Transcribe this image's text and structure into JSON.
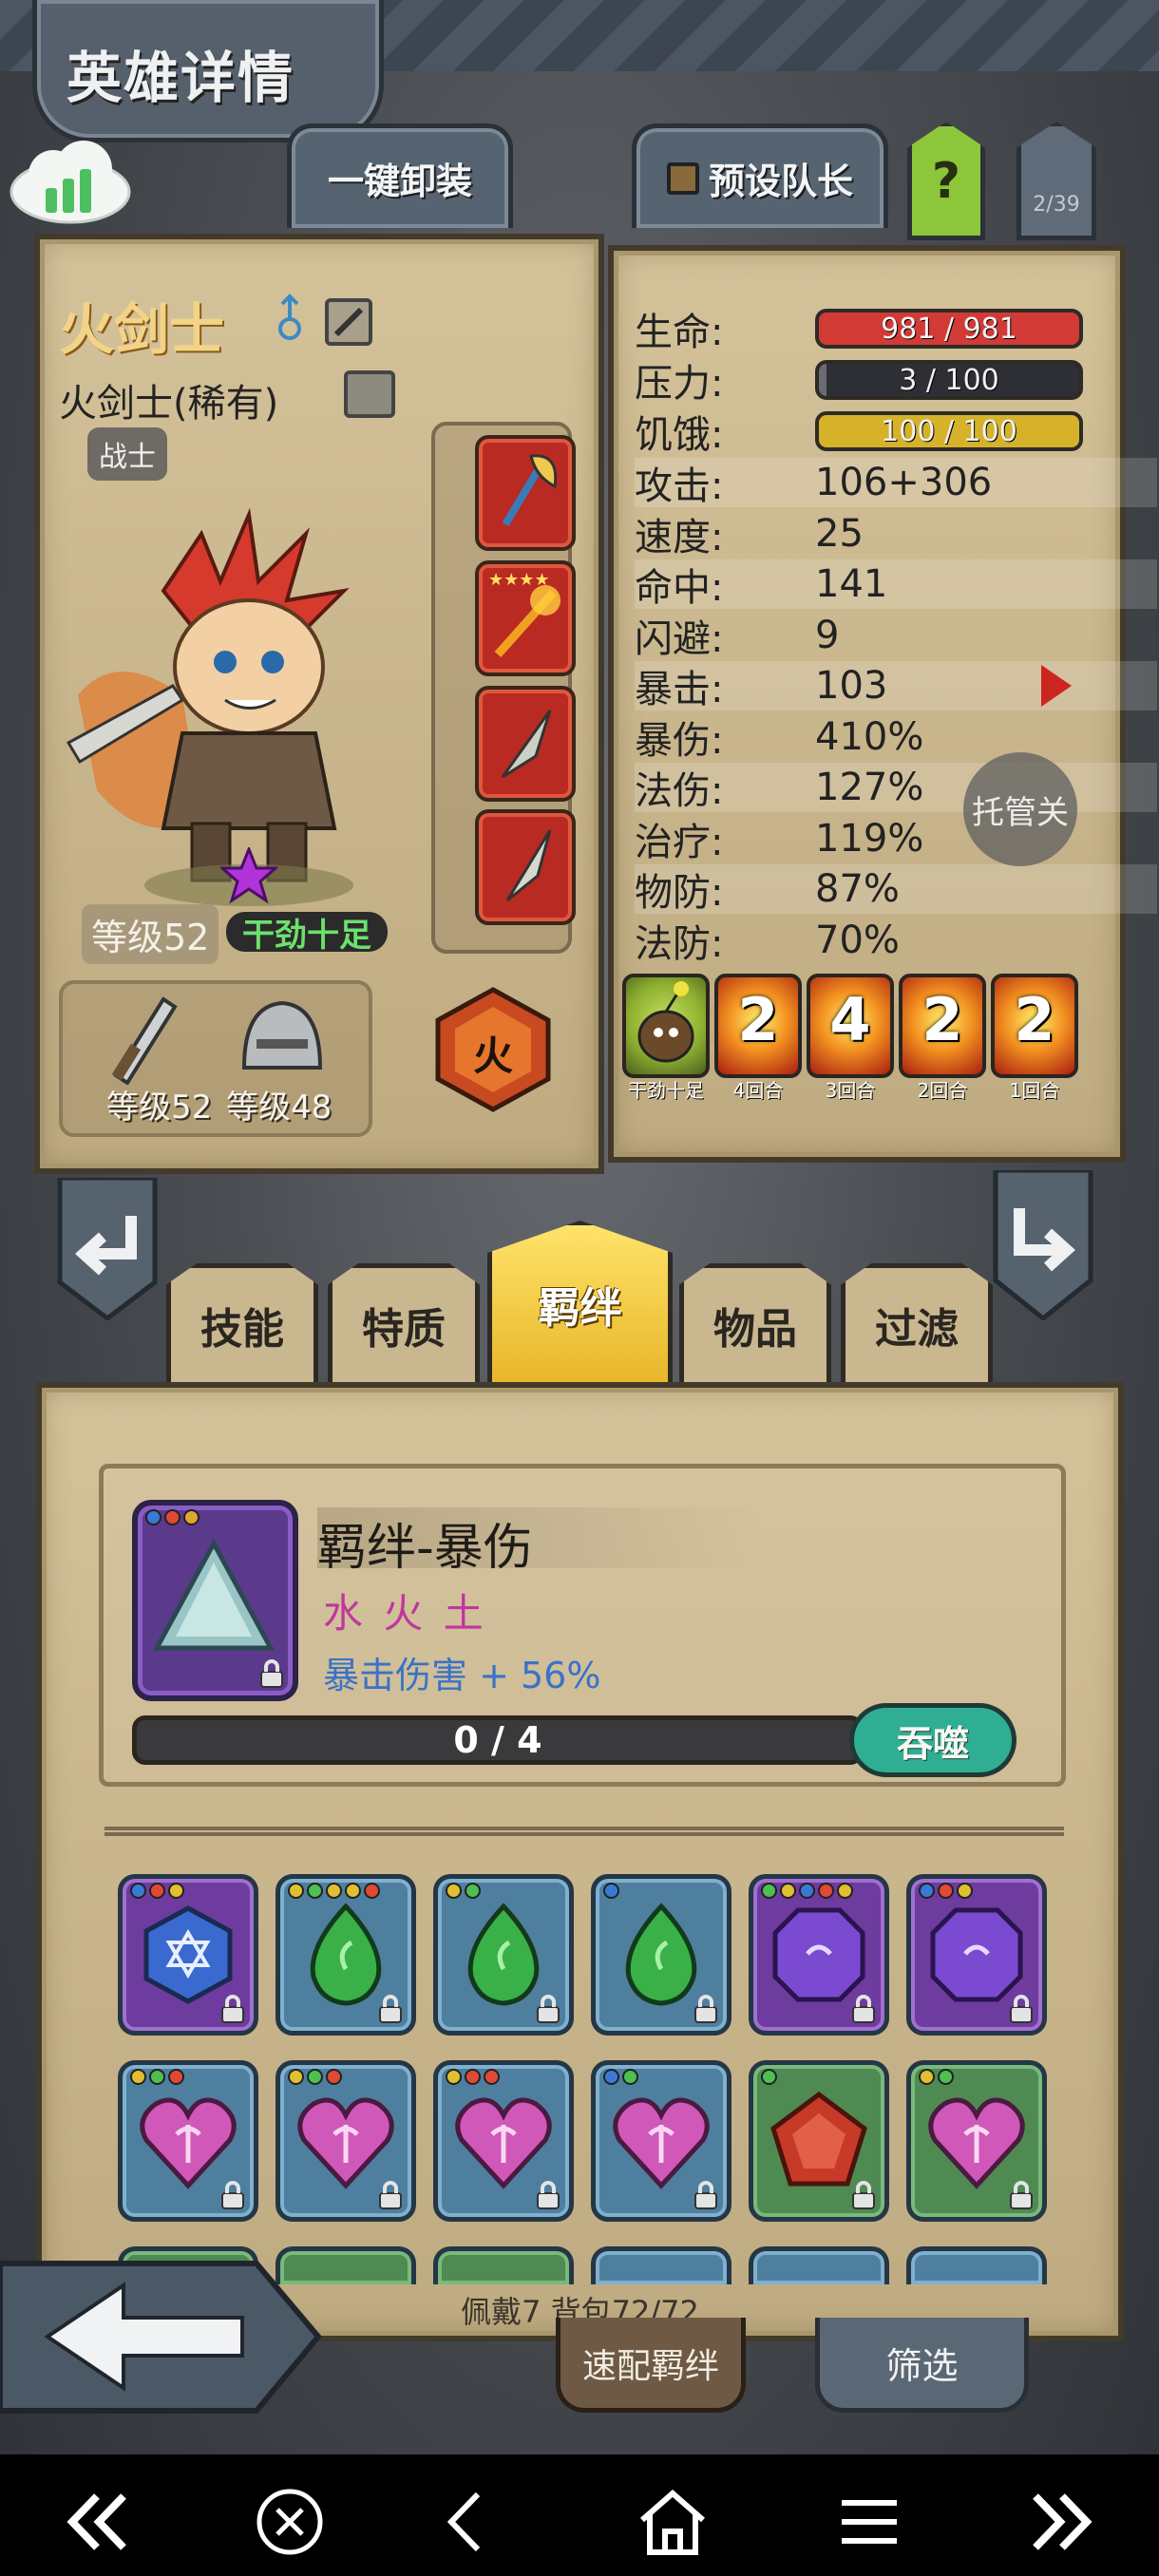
{
  "header": {
    "title": "英雄详情"
  },
  "top_tabs": {
    "unequip_all": "一键卸装",
    "preset_leader": "预设队长",
    "help": "?",
    "count": "2/39"
  },
  "hero": {
    "name": "火剑士",
    "class_rarity": "火剑士(稀有)",
    "role": "战士",
    "level": "等级52",
    "mood": "干劲十足",
    "weapon_level": "等级52",
    "armor_level": "等级48",
    "element_badge": "火"
  },
  "stats": {
    "hp_label": "生命:",
    "hp_value": "981 / 981",
    "hp_fill": 1.0,
    "stress_label": "压力:",
    "stress_value": "3 / 100",
    "stress_fill": 0.03,
    "hunger_label": "饥饿:",
    "hunger_value": "100 / 100",
    "hunger_fill": 1.0,
    "rows": [
      {
        "label": "攻击:",
        "value": "106+306"
      },
      {
        "label": "速度:",
        "value": "25"
      },
      {
        "label": "命中:",
        "value": "141"
      },
      {
        "label": "闪避:",
        "value": "9"
      },
      {
        "label": "暴击:",
        "value": "103"
      },
      {
        "label": "暴伤:",
        "value": "410%"
      },
      {
        "label": "法伤:",
        "value": "127%"
      },
      {
        "label": "治疗:",
        "value": "119%"
      },
      {
        "label": "物防:",
        "value": "87%"
      },
      {
        "label": "法防:",
        "value": "70%"
      }
    ],
    "auto_button": "托管关"
  },
  "buffs": [
    {
      "caption": "干劲十足",
      "num": ""
    },
    {
      "caption": "4回合",
      "num": "2"
    },
    {
      "caption": "3回合",
      "num": "4"
    },
    {
      "caption": "2回合",
      "num": "2"
    },
    {
      "caption": "1回合",
      "num": "2"
    }
  ],
  "nav_tabs": {
    "skills": "技能",
    "traits": "特质",
    "bonds": "羁绊",
    "items": "物品",
    "filter": "过滤"
  },
  "bond": {
    "title": "羁绊-暴伤",
    "elements": "水 火 土",
    "effect": "暴击伤害 + 56%",
    "progress": "0 / 4",
    "progress_fill": 0,
    "action_button": "吞噬"
  },
  "inventory": {
    "footer": "佩戴7 背包72/72",
    "quick_bond_button": "速配羁绊",
    "filter_button": "筛选"
  },
  "system_nav": [
    "first-page-icon",
    "close-icon",
    "back-icon",
    "home-icon",
    "menu-icon",
    "last-page-icon"
  ],
  "colors": {
    "hp": "#d23a36",
    "hunger": "#d6b22a",
    "stress": "#38393d",
    "magenta": "#c0379d",
    "blue": "#3a72c8",
    "teal": "#2fae93"
  }
}
